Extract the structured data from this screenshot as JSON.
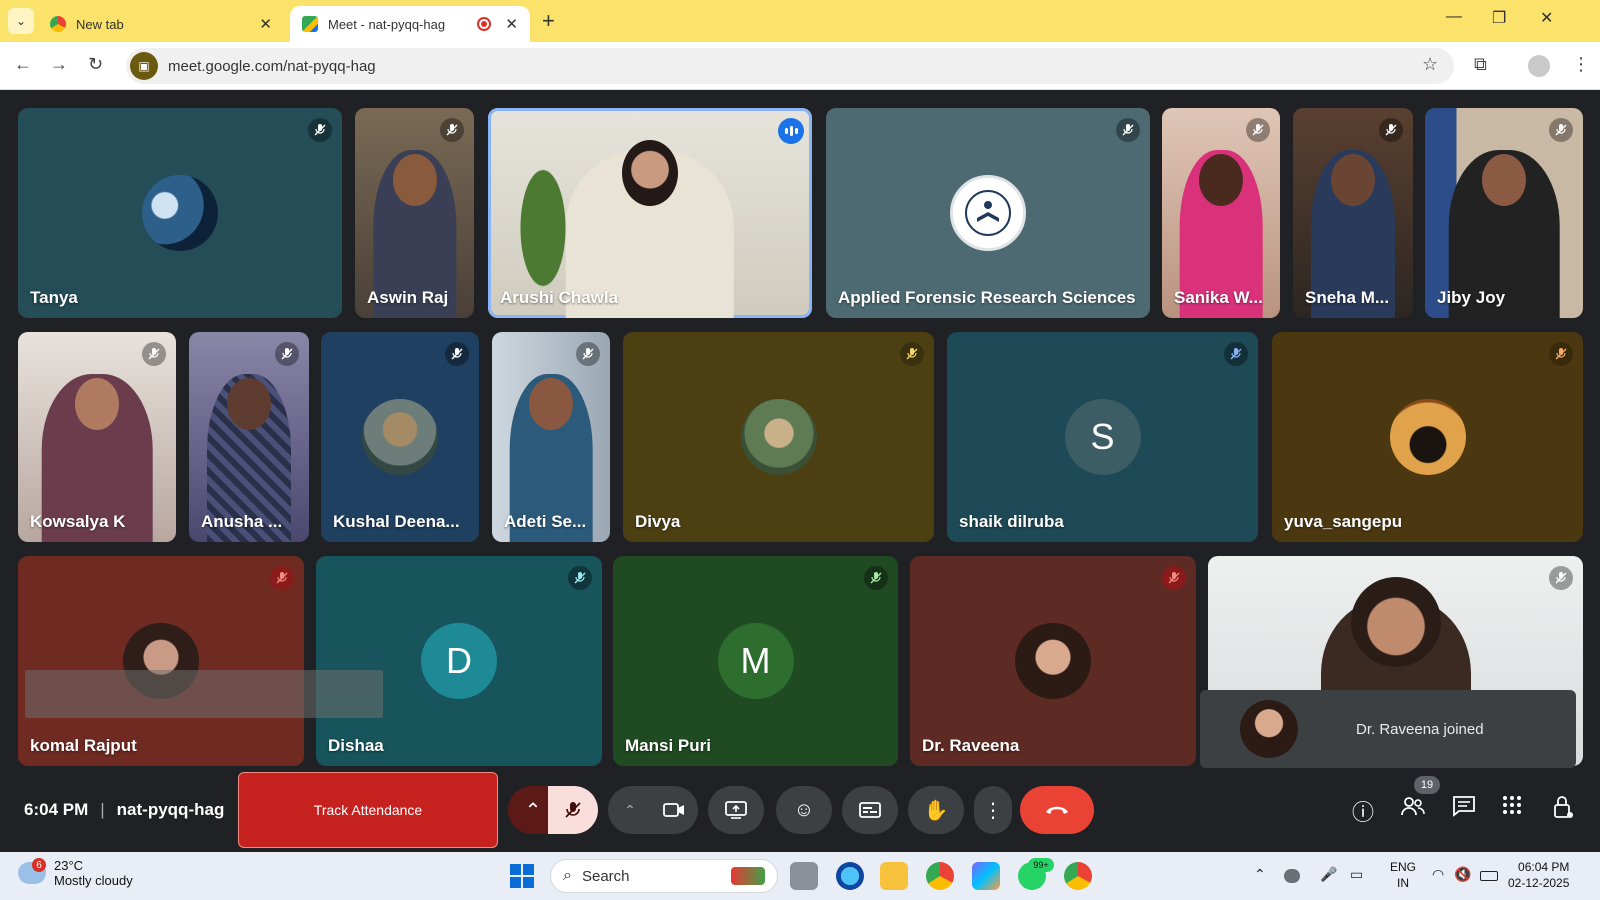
{
  "browser": {
    "tabs": [
      {
        "title": "New tab",
        "close": "✕"
      },
      {
        "title": "Meet - nat-pyqq-hag",
        "close": "✕"
      }
    ],
    "new_tab": "+",
    "window_controls": {
      "minimize": "—",
      "maximize": "❐",
      "close": "✕"
    },
    "url": "meet.google.com/nat-pyqq-hag"
  },
  "participants": [
    {
      "name": "Tanya"
    },
    {
      "name": "Aswin Raj"
    },
    {
      "name": "Arushi Chawla"
    },
    {
      "name": "Applied Forensic Research Sciences"
    },
    {
      "name": "Sanika W..."
    },
    {
      "name": "Sneha M..."
    },
    {
      "name": "Jiby Joy"
    },
    {
      "name": "Kowsalya K"
    },
    {
      "name": "Anusha ..."
    },
    {
      "name": "Kushal Deena..."
    },
    {
      "name": "Adeti Se..."
    },
    {
      "name": "Divya"
    },
    {
      "name": "shaik dilruba",
      "initial": "S"
    },
    {
      "name": "yuva_sangepu"
    },
    {
      "name": "komal Rajput"
    },
    {
      "name": "Dishaa",
      "initial": "D"
    },
    {
      "name": "Mansi Puri",
      "initial": "M"
    },
    {
      "name": "Dr. Raveena"
    }
  ],
  "toast": {
    "text": "Dr. Raveena joined"
  },
  "meeting": {
    "time": "6:04 PM",
    "separator": "|",
    "code": "nat-pyqq-hag",
    "track_attendance": "Track Attendance",
    "people_count": "19"
  },
  "taskbar": {
    "weather": {
      "badge": "6",
      "temp": "23°C",
      "condition": "Mostly cloudy"
    },
    "search_label": "Search",
    "whatsapp_badge": "99+",
    "lang": {
      "line1": "ENG",
      "line2": "IN"
    },
    "clock": {
      "time": "06:04 PM",
      "date": "02-12-2025"
    }
  },
  "colors": {
    "tab_strip": "#fbe36b",
    "end_call": "#ea4335",
    "track_attendance": "#c5221f",
    "speaking_indicator": "#1a73e8"
  }
}
